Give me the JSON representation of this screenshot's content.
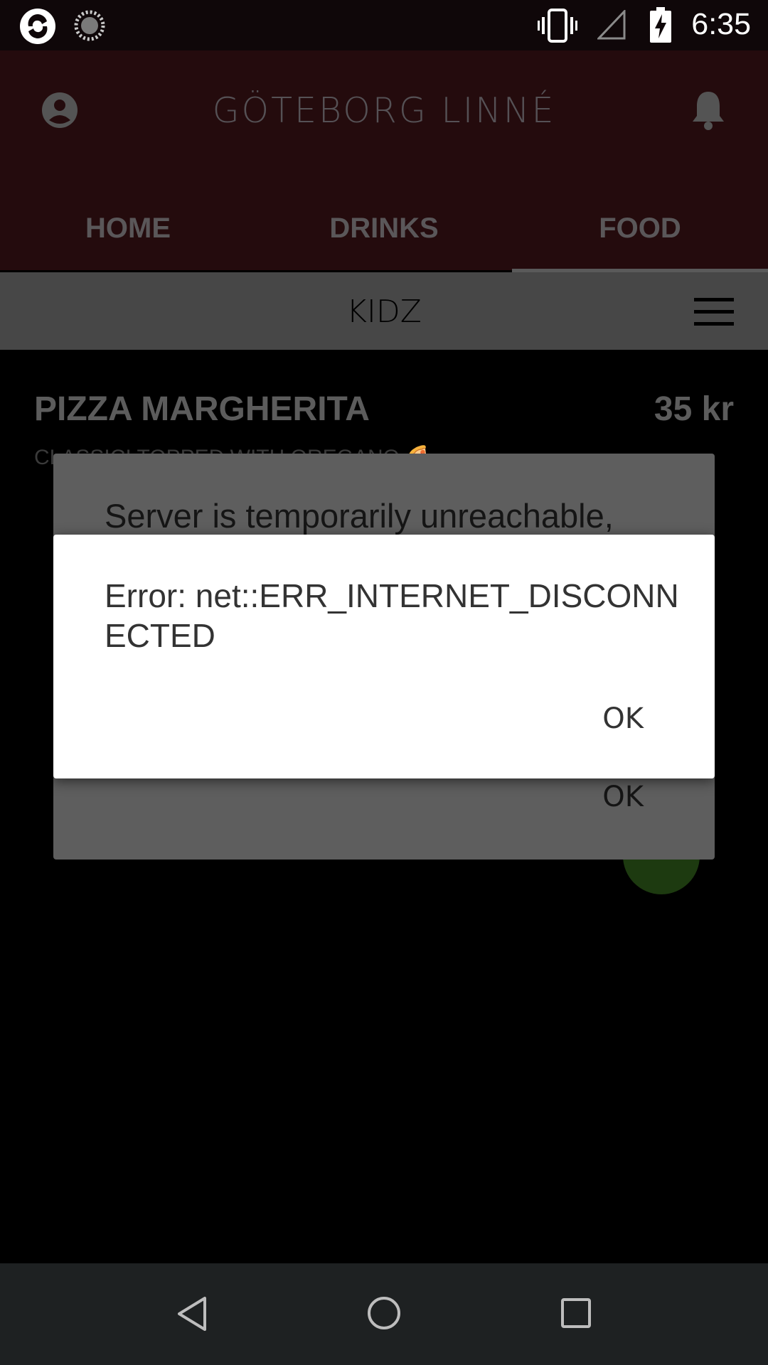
{
  "status_bar": {
    "time": "6:35",
    "icons": [
      "app-logo-icon",
      "loading-spinner-icon",
      "vibrate-icon",
      "no-signal-icon",
      "battery-charging-icon"
    ]
  },
  "header": {
    "venue": "GÖTEBORG LINNÉ",
    "tabs": [
      {
        "label": "HOME"
      },
      {
        "label": "DRINKS"
      },
      {
        "label": "FOOD",
        "selected": true
      }
    ]
  },
  "subheader": {
    "title": "KIDZ"
  },
  "menu_item": {
    "name": "PIZZA MARGHERITA",
    "price": "35 kr",
    "description": "CLASSIC! TOPPED WITH OREGANO 🍕"
  },
  "dialog_back": {
    "message": "Server is temporarily unreachable,",
    "ok_label": "OK"
  },
  "dialog_front": {
    "message": "Error: net::ERR_INTERNET_DISCONNECTED",
    "ok_label": "OK"
  },
  "colors": {
    "header_bg": "#240b0d",
    "scrim": "#000000",
    "dialog_bg": "#ffffff",
    "fab": "#1d3a10"
  }
}
